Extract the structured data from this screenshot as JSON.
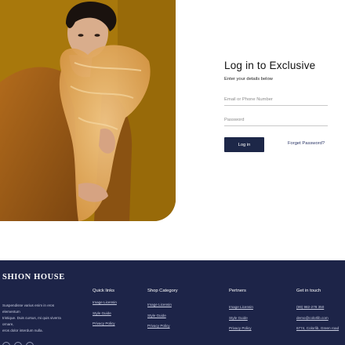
{
  "hero": {
    "image": "model-in-mustard-coat-with-tulle-scarf"
  },
  "login": {
    "title": "Log in to Exclusive",
    "subtitle": "Enter your details below",
    "email_placeholder": "Email or Phone Number",
    "password_placeholder": "Password",
    "login_label": "Log in",
    "forgot_label": "Forget Password?"
  },
  "footer": {
    "brand": "SHION HOUSE",
    "blurb": [
      "Suspendisse varius enim in eros",
      "elementum",
      "tristique. Duis cursus, mi quis viverra",
      "ornare,",
      "eros dolor interdum nulla."
    ],
    "columns": [
      {
        "title": "Quick links",
        "items": [
          "Image Licensin",
          "Style Guide",
          "Privacy Policy"
        ]
      },
      {
        "title": "Shop Category",
        "items": [
          "Image Licensin",
          "Style Guide",
          "Privacy Policy"
        ]
      },
      {
        "title": "Pertners",
        "items": [
          "Image Licensin",
          "Style Guide",
          "Privacy Policy"
        ]
      },
      {
        "title": "Get in touch",
        "items": [
          "(99) 982-278 350",
          "demo@colorlib.com",
          "6774, Colorlib, Green road"
        ]
      }
    ],
    "socials": [
      "facebook-icon",
      "twitter-icon",
      "instagram-icon"
    ]
  },
  "colors": {
    "accent": "#1d2748",
    "footer_bg": "#1d2448",
    "photo_bg": "#a06e0a"
  }
}
